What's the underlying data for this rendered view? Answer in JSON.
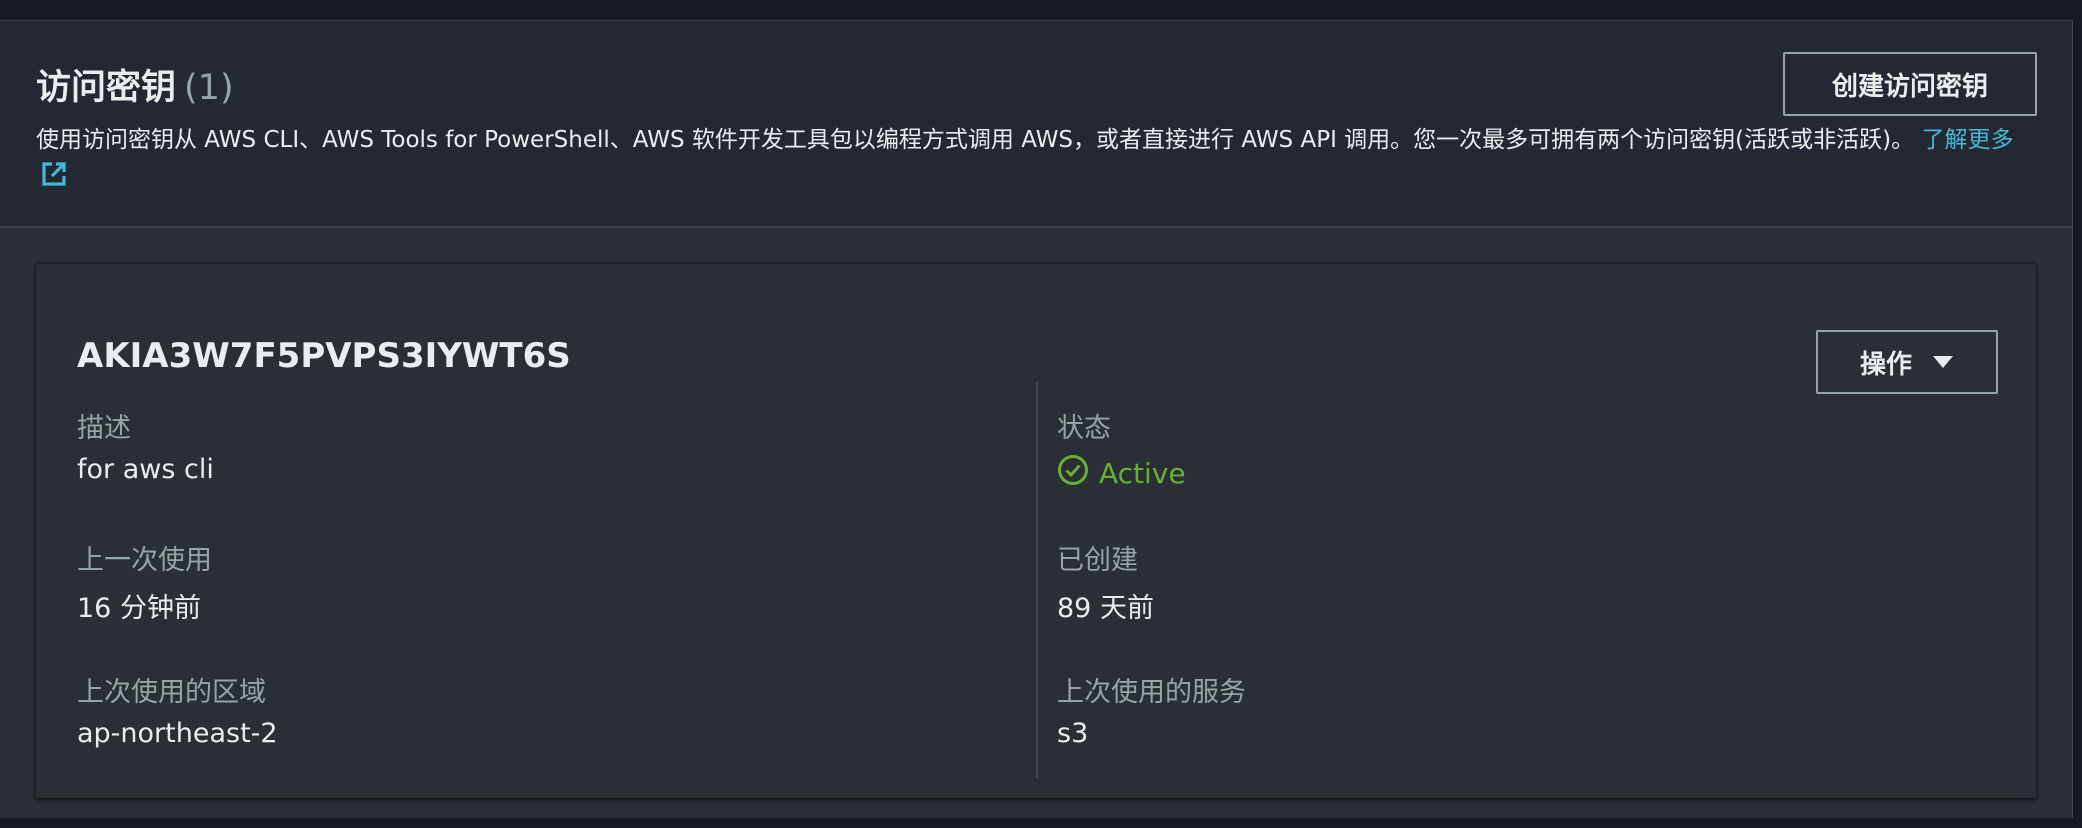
{
  "section": {
    "title": "访问密钥",
    "count": "(1)",
    "description": "使用访问密钥从 AWS CLI、AWS Tools for PowerShell、AWS 软件开发工具包以编程方式调用 AWS，或者直接进行 AWS API 调用。您一次最多可拥有两个访问密钥(活跃或非活跃)。",
    "learn_more": "了解更多",
    "create_button": "创建访问密钥"
  },
  "access_key": {
    "id": "AKIA3W7F5PVPS3IYWT6S",
    "actions_button": "操作",
    "description_label": "描述",
    "description_value": "for aws cli",
    "status_label": "状态",
    "status_value": "Active",
    "last_used_label": "上一次使用",
    "last_used_value": "16 分钟前",
    "created_label": "已创建",
    "created_value": "89 天前",
    "last_region_label": "上次使用的区域",
    "last_region_value": "ap-northeast-2",
    "last_service_label": "上次使用的服务",
    "last_service_value": "s3"
  },
  "colors": {
    "link": "#44b9d6",
    "status_active": "#6aaf35",
    "label": "#95a5a6",
    "text": "#eaeded"
  },
  "icons": {
    "learn_more": "external-link-icon",
    "actions": "caret-down-icon",
    "status": "check-circle-icon"
  }
}
